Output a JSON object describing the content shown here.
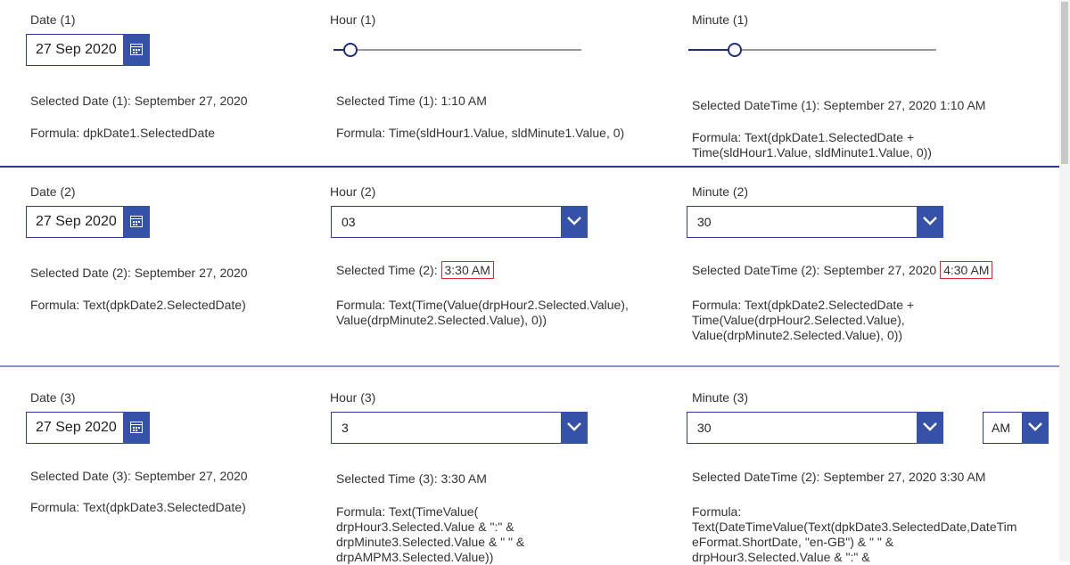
{
  "colors": {
    "accent": "#3651a8",
    "border": "#2b3a8f",
    "highlight": "#e0262e",
    "divider": "#2b3a8f"
  },
  "section1": {
    "date_label": "Date (1)",
    "date_value": "27 Sep 2020",
    "hour_label": "Hour (1)",
    "hour_value": 1,
    "minute_label": "Minute (1)",
    "minute_value": 10,
    "selected_date": "Selected Date (1): September 27, 2020",
    "formula_date": "Formula: dpkDate1.SelectedDate",
    "selected_time": "Selected Time (1): 1:10 AM",
    "formula_time": "Formula: Time(sldHour1.Value, sldMinute1.Value, 0)",
    "selected_datetime": "Selected DateTime (1): September 27, 2020 1:10 AM",
    "formula_datetime_1": "Formula: Text(dpkDate1.SelectedDate +",
    "formula_datetime_2": "Time(sldHour1.Value, sldMinute1.Value, 0))"
  },
  "section2": {
    "date_label": "Date (2)",
    "date_value": "27 Sep 2020",
    "hour_label": "Hour (2)",
    "hour_value": "03",
    "minute_label": "Minute (2)",
    "minute_value": "30",
    "selected_date": "Selected Date (2): September 27, 2020",
    "formula_date": "Formula: Text(dpkDate2.SelectedDate)",
    "selected_time_prefix": "Selected Time (2):",
    "selected_time_value": "3:30 AM",
    "formula_time_1": "Formula: Text(Time(Value(drpHour2.Selected.Value),",
    "formula_time_2": "Value(drpMinute2.Selected.Value), 0))",
    "selected_datetime_prefix": "Selected DateTime (2): September 27, 2020",
    "selected_datetime_value": "4:30 AM",
    "formula_datetime_1": "Formula: Text(dpkDate2.SelectedDate +",
    "formula_datetime_2": "Time(Value(drpHour2.Selected.Value),",
    "formula_datetime_3": "Value(drpMinute2.Selected.Value), 0))"
  },
  "section3": {
    "date_label": "Date (3)",
    "date_value": "27 Sep 2020",
    "hour_label": "Hour (3)",
    "hour_value": "3",
    "minute_label": "Minute (3)",
    "minute_value": "30",
    "ampm_value": "AM",
    "selected_date": "Selected Date (3): September 27, 2020",
    "formula_date": "Formula: Text(dpkDate3.SelectedDate)",
    "selected_time": "Selected Time (3): 3:30 AM",
    "formula_time_1": "Formula: Text(TimeValue(",
    "formula_time_2": "drpHour3.Selected.Value & \":\" &",
    "formula_time_3": "drpMinute3.Selected.Value & \" \" &",
    "formula_time_4": "drpAMPM3.Selected.Value))",
    "selected_datetime": "Selected DateTime (2): September 27, 2020 3:30 AM",
    "formula_datetime_1": "Formula:",
    "formula_datetime_2": "Text(DateTimeValue(Text(dpkDate3.SelectedDate,DateTim",
    "formula_datetime_3": "eFormat.ShortDate, \"en-GB\") & \" \" &",
    "formula_datetime_4": "drpHour3.Selected.Value & \":\" &"
  },
  "slider_ranges": {
    "hour_max": 23,
    "minute_max": 59
  }
}
